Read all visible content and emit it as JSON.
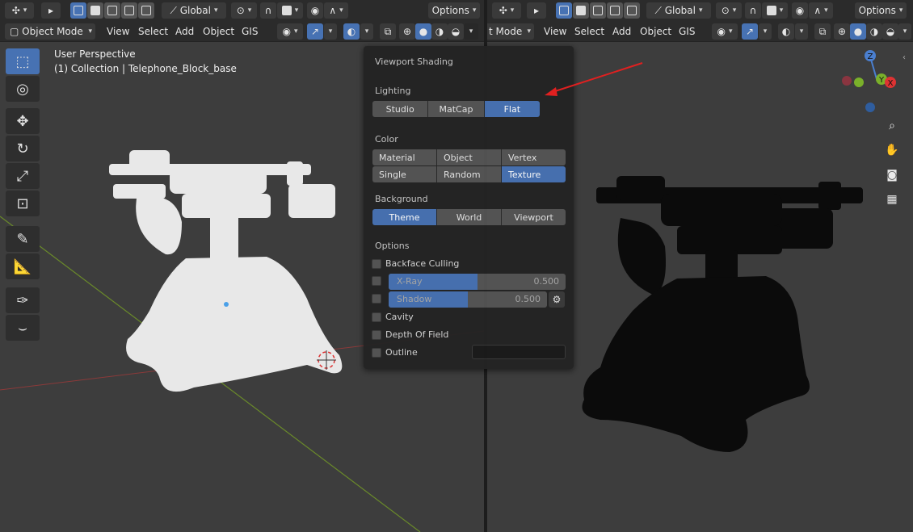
{
  "colors": {
    "accent": "#4772b3",
    "header_bg": "#2b2b2b",
    "viewport_bg": "#3d3d3d",
    "grid_x_axis": "#8b3a3a",
    "grid_y_axis": "#6a8a2a",
    "model_left": "#e8e8e8",
    "model_right": "#0b0b0b",
    "annotation_arrow": "#e02020"
  },
  "left": {
    "header1": {
      "transform_orientation": "Global",
      "options_label": "Options"
    },
    "header2": {
      "mode_label": "Object Mode",
      "menus": [
        "View",
        "Select",
        "Add",
        "Object",
        "GIS"
      ]
    },
    "viewport_info": {
      "line1": "User Perspective",
      "line2": "(1) Collection | Telephone_Block_base"
    },
    "tools": [
      "select-box-icon",
      "cursor-icon",
      "move-icon",
      "rotate-icon",
      "scale-icon",
      "transform-icon",
      "annotate-icon",
      "measure-icon",
      "grease-pencil-icon",
      "curve-icon"
    ]
  },
  "right": {
    "header1": {
      "transform_orientation": "Global",
      "options_label": "Options"
    },
    "header2": {
      "mode_label_partial": "t Mode",
      "menus": [
        "View",
        "Select",
        "Add",
        "Object",
        "GIS"
      ]
    },
    "gizmo": {
      "z": "Z",
      "y": "Y",
      "x": "X"
    }
  },
  "popover": {
    "title": "Viewport Shading",
    "lighting": {
      "label": "Lighting",
      "options": [
        "Studio",
        "MatCap",
        "Flat"
      ],
      "selected": "Flat"
    },
    "color": {
      "label": "Color",
      "options": [
        "Material",
        "Object",
        "Vertex",
        "Single",
        "Random",
        "Texture"
      ],
      "selected": "Texture"
    },
    "background": {
      "label": "Background",
      "options": [
        "Theme",
        "World",
        "Viewport"
      ],
      "selected": "Theme"
    },
    "options": {
      "label": "Options",
      "backface_culling": "Backface Culling",
      "xray_label": "X-Ray",
      "xray_value": "0.500",
      "xray_fraction": 0.5,
      "shadow_label": "Shadow",
      "shadow_value": "0.500",
      "shadow_fraction": 0.5,
      "cavity": "Cavity",
      "depth_of_field": "Depth Of Field",
      "outline": "Outline"
    }
  }
}
